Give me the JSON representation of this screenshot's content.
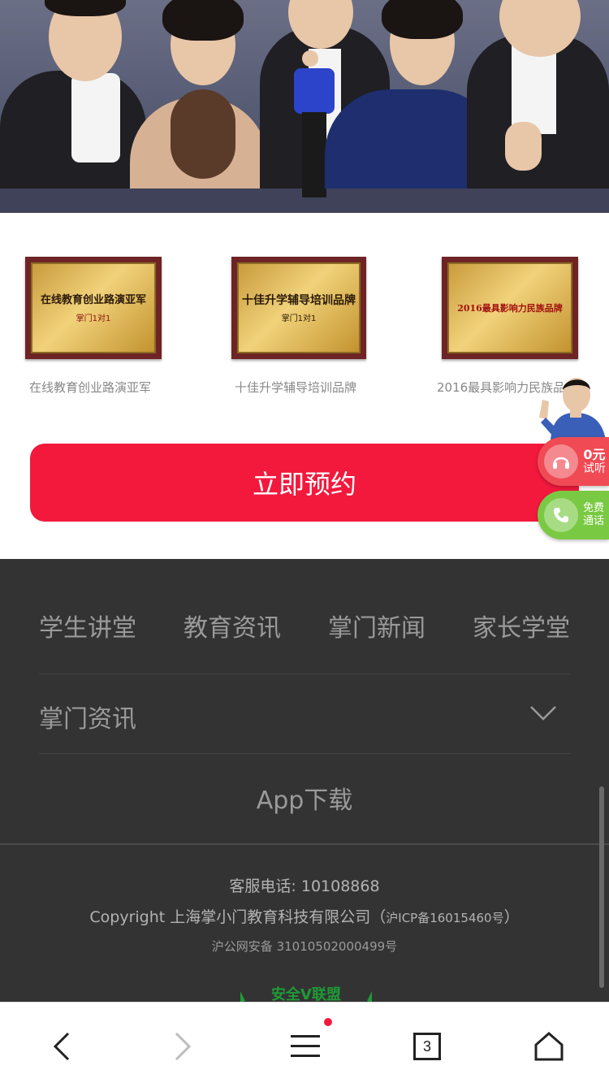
{
  "awards": [
    {
      "plate_lines": [
        "在线教育创业路演亚军",
        "掌门1对1"
      ],
      "caption": "在线教育创业路演亚军"
    },
    {
      "plate_lines": [
        "十佳升学辅导培训品牌",
        "掌门1对1"
      ],
      "caption": "十佳升学辅导培训品牌"
    },
    {
      "plate_lines": [
        "2016最具影响力民族品牌"
      ],
      "caption": "2016最具影响力民族品"
    }
  ],
  "cta": {
    "label": "立即预约"
  },
  "floating": {
    "trial": {
      "line1": "0元",
      "line2": "试听"
    },
    "call": {
      "line1": "免费",
      "line2": "通话"
    }
  },
  "footer": {
    "nav": [
      "学生讲堂",
      "教育资讯",
      "掌门新闻",
      "家长学堂"
    ],
    "news_label": "掌门资讯",
    "app_download": "App下载",
    "phone": "客服电话: 10108868",
    "copyright": "Copyright 上海掌小门教育科技有限公司（",
    "icp": "沪ICP备16015460号",
    "copyright_end": "）",
    "police": "沪公网安备 31010502000499号",
    "safe_logo_text": "安全V联盟"
  },
  "browser": {
    "tab_count": "3"
  },
  "icons": [
    "back-icon",
    "forward-icon",
    "menu-icon",
    "tabs-icon",
    "home-icon",
    "headset-icon",
    "phone-icon",
    "chevron-down-icon"
  ],
  "colors": {
    "accent": "#f2193d",
    "call_green": "#7ac943",
    "footer_bg": "#333333"
  }
}
